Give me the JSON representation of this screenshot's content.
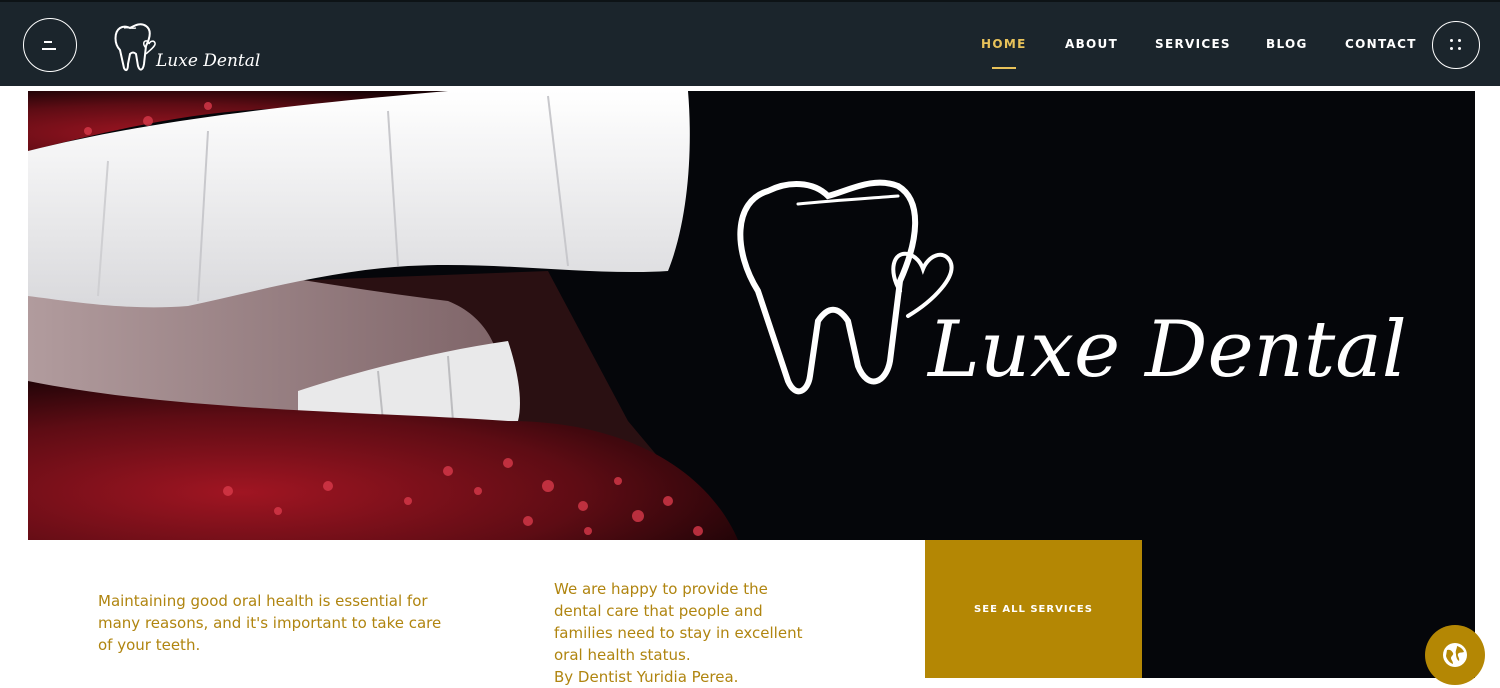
{
  "brand": {
    "name": "Luxe Dental"
  },
  "nav": {
    "items": [
      {
        "label": "HOME",
        "active": true
      },
      {
        "label": "ABOUT",
        "active": false
      },
      {
        "label": "SERVICES",
        "active": false
      },
      {
        "label": "BLOG",
        "active": false
      },
      {
        "label": "CONTACT",
        "active": false
      }
    ]
  },
  "hero": {
    "logo_text": "Luxe Dental"
  },
  "info": {
    "left_text": "Maintaining good oral health is essential for many reasons, and it's important to take care of your teeth.",
    "right_lines": [
      "We are happy to provide the",
      "dental care that people and",
      "families need to stay in excellent",
      "oral health status.",
      "By Dentist Yuridia Perea."
    ],
    "services_button": "SEE ALL SERVICES"
  },
  "colors": {
    "header_bg": "#1b252c",
    "accent_gold": "#b48704",
    "nav_active": "#e8c25a",
    "text_gold": "#b08510"
  }
}
